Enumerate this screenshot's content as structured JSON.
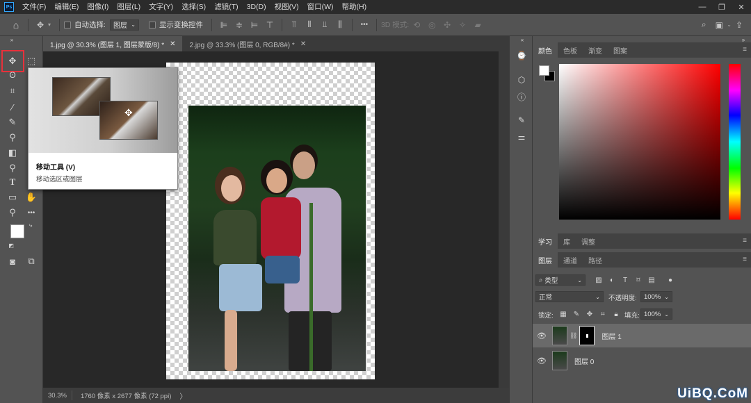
{
  "app": {
    "logo": "Ps"
  },
  "menu": [
    "文件(F)",
    "编辑(E)",
    "图像(I)",
    "图层(L)",
    "文字(Y)",
    "选择(S)",
    "滤镜(T)",
    "3D(D)",
    "视图(V)",
    "窗口(W)",
    "帮助(H)"
  ],
  "window_controls": {
    "minimize": "—",
    "restore": "❐",
    "close": "✕"
  },
  "options_bar": {
    "auto_select_label": "自动选择:",
    "auto_select_value": "图层",
    "show_transform_label": "显示变换控件",
    "more": "•••",
    "mode_3d_label": "3D 模式:"
  },
  "tabs": [
    {
      "label": "1.jpg @ 30.3% (图层 1, 图层蒙版/8) *",
      "active": true
    },
    {
      "label": "2.jpg @ 33.3% (图层 0, RGB/8#) *",
      "active": false
    }
  ],
  "tooltip": {
    "title": "移动工具 (V)",
    "description": "移动选区或图层"
  },
  "status": {
    "zoom": "30.3%",
    "doc_info": "1760 像素 x 2677 像素 (72 ppi)",
    "arrow": "〉"
  },
  "panels": {
    "color_tabs": [
      "颜色",
      "色板",
      "渐变",
      "图案"
    ],
    "learn_tabs": [
      "学习",
      "库",
      "调整"
    ],
    "layer_tabs": [
      "图层",
      "通道",
      "路径"
    ],
    "filter_type": "类型",
    "blend_mode": "正常",
    "opacity_label": "不透明度:",
    "opacity_value": "100%",
    "lock_label": "锁定:",
    "fill_label": "填充:",
    "fill_value": "100%",
    "layers": [
      {
        "name": "图层 1",
        "selected": true,
        "has_mask": true
      },
      {
        "name": "图层 0",
        "selected": false,
        "has_mask": false
      }
    ]
  },
  "colors": {
    "foreground": "#ffffff",
    "background": "#000000",
    "highlight": "#e8313b"
  },
  "watermark": "UiBQ.CoM"
}
